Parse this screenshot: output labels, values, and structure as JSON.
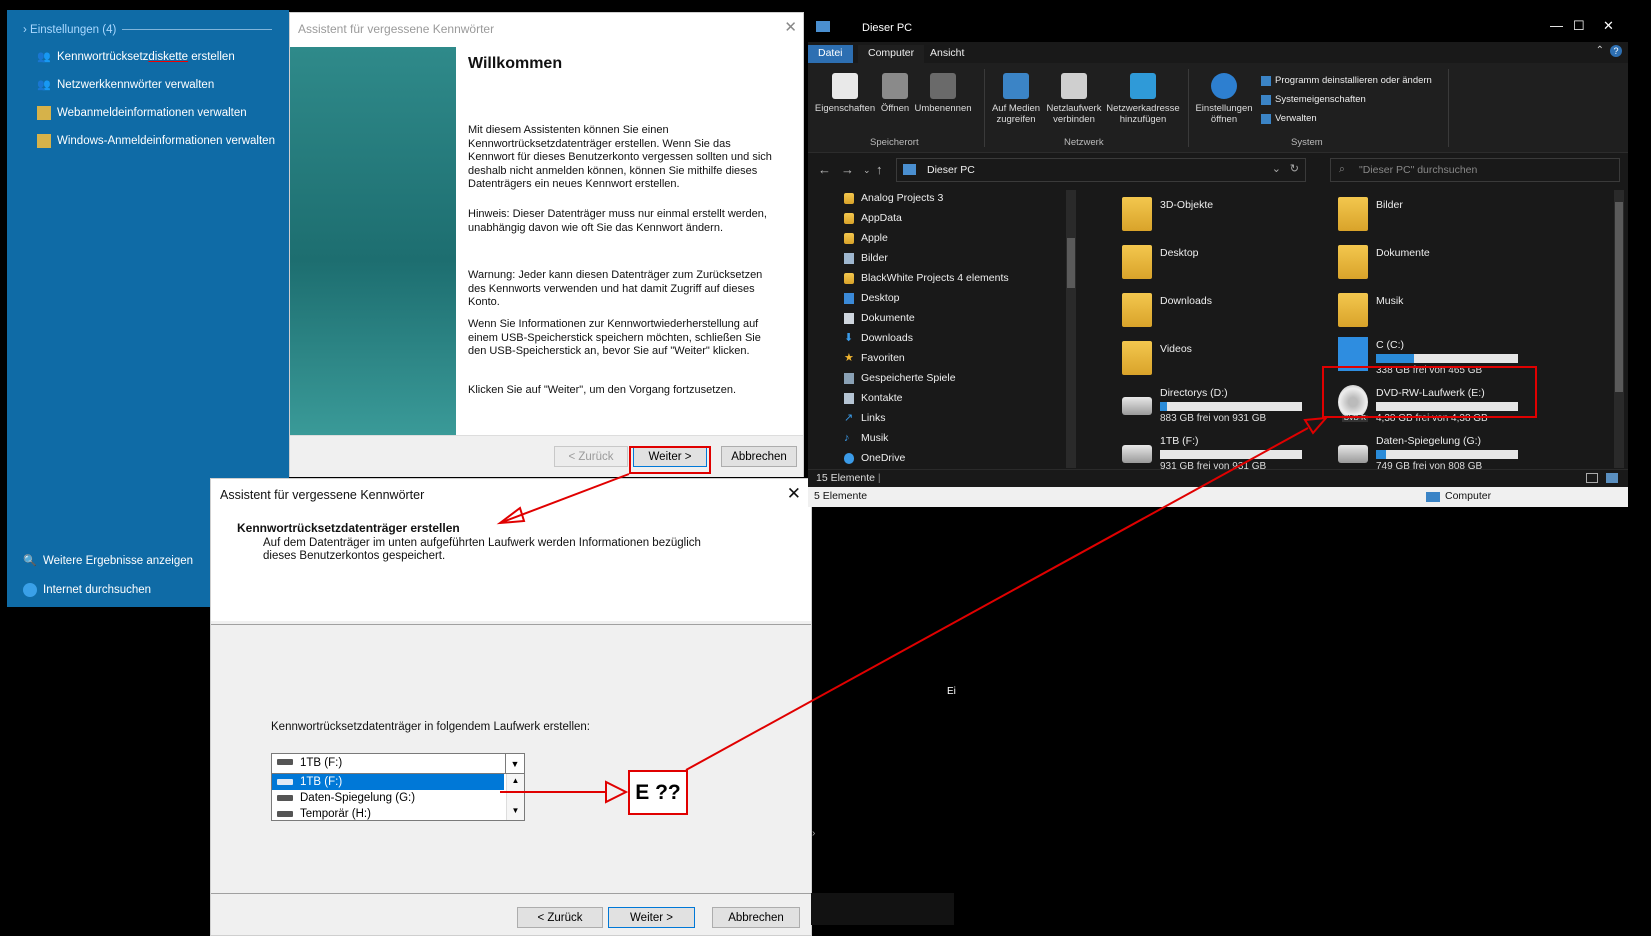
{
  "search_panel": {
    "header": "Einstellungen (4)",
    "items": [
      {
        "label_a": "Kennwortrücksetz",
        "label_b": "diskette",
        "label_c": " erstellen",
        "icon": "user-key-icon"
      },
      {
        "label": "Netzwerkkennwörter verwalten",
        "icon": "user-key-icon"
      },
      {
        "label": "Webanmeldeinformationen verwalten",
        "icon": "credential-vault-icon"
      },
      {
        "label": "Windows-Anmeldeinformationen verwalten",
        "icon": "credential-vault-icon"
      }
    ],
    "more_results": "Weitere Ergebnisse anzeigen",
    "internet": "Internet durchsuchen"
  },
  "wizard1": {
    "title": "Assistent für vergessene Kennwörter",
    "heading": "Willkommen",
    "paragraphs": [
      "Mit diesem Assistenten können Sie einen Kennwortrücksetzdatenträger erstellen. Wenn Sie das Kennwort für dieses Benutzerkonto vergessen sollten und sich deshalb nicht anmelden können, können Sie mithilfe dieses Datenträgers ein neues Kennwort erstellen.",
      "Hinweis: Dieser Datenträger muss nur einmal erstellt werden, unabhängig davon wie oft Sie das Kennwort ändern.",
      "Warnung: Jeder kann diesen Datenträger zum Zurücksetzen des Kennworts verwenden und hat damit Zugriff auf dieses Konto.",
      "Wenn Sie Informationen zur Kennwortwiederherstellung auf einem USB-Speicherstick speichern möchten, schließen Sie den USB-Speicherstick an, bevor Sie auf \"Weiter\" klicken.",
      "Klicken Sie auf \"Weiter\", um den Vorgang fortzusetzen."
    ],
    "back": "< Zurück",
    "next": "Weiter >",
    "cancel": "Abbrechen"
  },
  "wizard2": {
    "title": "Assistent für vergessene Kennwörter",
    "heading": "Kennwortrücksetzdatenträger erstellen",
    "subtext": "Auf dem Datenträger im unten aufgeführten Laufwerk werden Informationen bezüglich dieses Benutzerkontos gespeichert.",
    "drive_label": "Kennwortrücksetzdatenträger in folgendem Laufwerk erstellen:",
    "combo_value": "1TB (F:)",
    "options": [
      "1TB (F:)",
      "Daten-Spiegelung (G:)",
      "Temporär (H:)"
    ],
    "back": "< Zurück",
    "next": "Weiter >",
    "cancel": "Abbrechen"
  },
  "annotation": {
    "text": "E ??",
    "color": "#e00000"
  },
  "explorer": {
    "title": "Dieser PC",
    "tabs": [
      "Datei",
      "Computer",
      "Ansicht"
    ],
    "ribbon": {
      "buttons": [
        "Eigenschaften",
        "Öffnen",
        "Umbenennen",
        "Auf Medien zugreifen",
        "Netzlaufwerk verbinden",
        "Netzwerkadresse hinzufügen",
        "Einstellungen öffnen"
      ],
      "system_links": [
        "Programm deinstallieren oder ändern",
        "Systemeigenschaften",
        "Verwalten"
      ],
      "groups": [
        "Speicherort",
        "Netzwerk",
        "System"
      ]
    },
    "address": "Dieser PC",
    "search_placeholder": "\"Dieser PC\" durchsuchen",
    "nav_items": [
      "Analog Projects 3",
      "AppData",
      "Apple",
      "Bilder",
      "BlackWhite Projects 4 elements",
      "Desktop",
      "Dokumente",
      "Downloads",
      "Favoriten",
      "Gespeicherte Spiele",
      "Kontakte",
      "Links",
      "Musik",
      "OneDrive"
    ],
    "folders": [
      "3D-Objekte",
      "Bilder",
      "Desktop",
      "Dokumente",
      "Downloads",
      "Musik",
      "Videos"
    ],
    "drives": [
      {
        "name": "C (C:)",
        "free": "338 GB frei von 465 GB",
        "used_fraction": 0.27
      },
      {
        "name": "Directorys (D:)",
        "free": "883 GB frei von 931 GB",
        "used_fraction": 0.05
      },
      {
        "name": "DVD-RW-Laufwerk (E:)",
        "free": "4,38 GB frei von 4,38 GB",
        "used_fraction": 0.0,
        "badge": "DVD-R"
      },
      {
        "name": "1TB (F:)",
        "free": "931 GB frei von 931 GB",
        "used_fraction": 0.0
      },
      {
        "name": "Daten-Spiegelung (G:)",
        "free": "749 GB frei von 808 GB",
        "used_fraction": 0.07
      }
    ],
    "status_count": "15 Elemente",
    "status_count2": "5 Elemente",
    "status_location": "Computer"
  },
  "misc": {
    "ei": "Ei",
    "chev": "›"
  }
}
